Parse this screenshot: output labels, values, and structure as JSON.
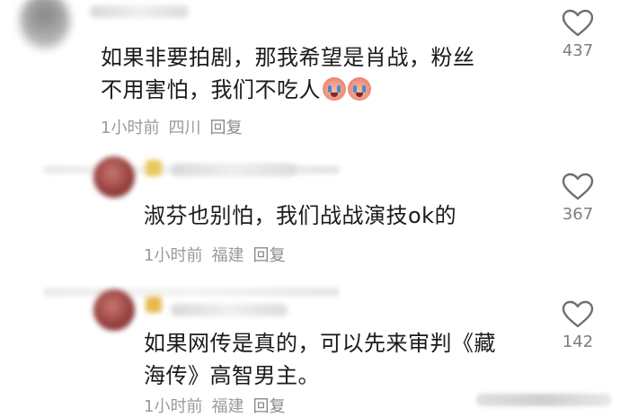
{
  "comments": [
    {
      "text_line1": "如果非要拍剧，那我希望是肖战，粉丝",
      "text_line2": "不用害怕，我们不吃人",
      "emojis": [
        "crying-face-emoji",
        "crying-face-emoji"
      ],
      "time": "1小时前",
      "location": "四川",
      "reply_label": "回复",
      "likes": "437"
    },
    {
      "text_line1": "淑芬也别怕，我们战战演技ok的",
      "time": "1小时前",
      "location": "福建",
      "reply_label": "回复",
      "likes": "367"
    },
    {
      "text_line1": "如果网传是真的，可以先来审判《藏",
      "text_line2": "海传》高智男主。",
      "time": "1小时前",
      "location": "福建",
      "reply_label": "回复",
      "likes": "142"
    }
  ],
  "icons": {
    "like": "heart-outline-icon"
  },
  "colors": {
    "meta_text": "#9a9a9a",
    "body_text": "#1a1a1a",
    "like_count": "#7d7d7d"
  }
}
